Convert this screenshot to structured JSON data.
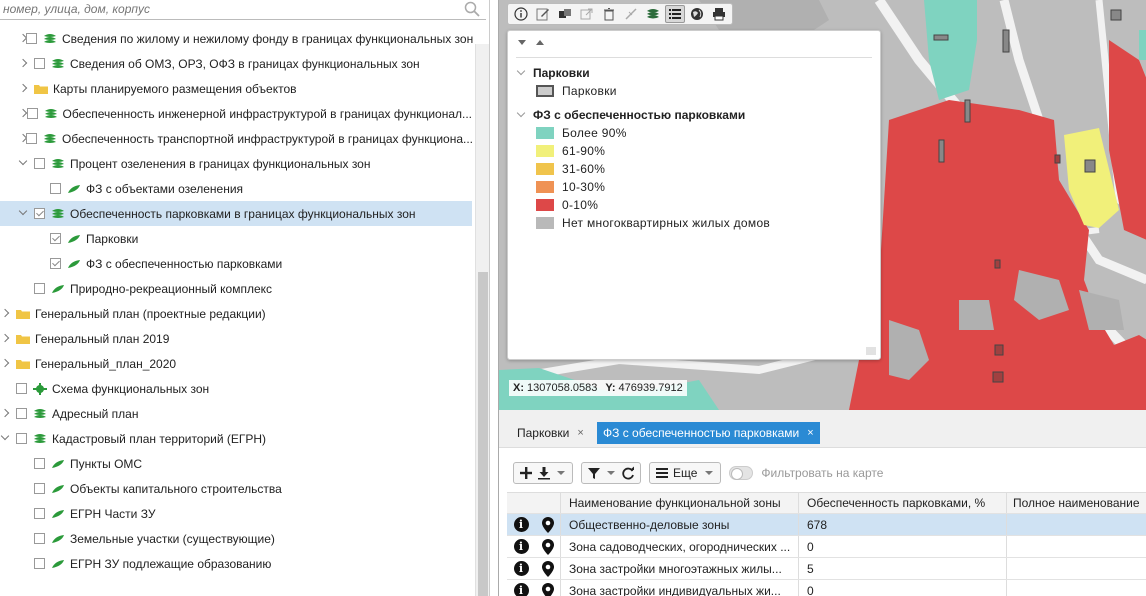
{
  "search": {
    "placeholder": "номер, улица, дом, корпус"
  },
  "tree": [
    {
      "label": "Сведения по жилому и нежилому фонду в границах функциональных зон"
    },
    {
      "label": "Сведения об ОМЗ, ОРЗ, ОФЗ в границах функциональных зон"
    },
    {
      "label": "Карты планируемого размещения объектов"
    },
    {
      "label": "Обеспеченность инженерной инфраструктурой в границах функционал..."
    },
    {
      "label": "Обеспеченность транспортной инфраструктурой в границах функциона..."
    },
    {
      "label": "Процент озеленения в границах функциональных зон"
    },
    {
      "label": "ФЗ с объектами озеленения"
    },
    {
      "label": "Обеспеченность парковками в границах функциональных зон"
    },
    {
      "label": "Парковки"
    },
    {
      "label": "ФЗ с обеспеченностью парковками"
    },
    {
      "label": "Природно-рекреационный комплекс"
    },
    {
      "label": "Генеральный план (проектные редакции)"
    },
    {
      "label": "Генеральный план 2019"
    },
    {
      "label": "Генеральный_план_2020"
    },
    {
      "label": "Схема функциональных зон"
    },
    {
      "label": "Адресный план"
    },
    {
      "label": "Кадастровый план территорий (ЕГРН)"
    },
    {
      "label": "Пункты ОМС"
    },
    {
      "label": "Объекты капитального строительства"
    },
    {
      "label": "ЕГРН Части ЗУ"
    },
    {
      "label": "Земельные участки (существующие)"
    },
    {
      "label": "ЕГРН ЗУ подлежащие образованию"
    }
  ],
  "map_toolbar": [
    {
      "icon": "info-icon"
    },
    {
      "icon": "edit-icon"
    },
    {
      "icon": "layers-swap-icon"
    },
    {
      "icon": "export-icon"
    },
    {
      "icon": "trash-icon"
    },
    {
      "icon": "measure-icon"
    },
    {
      "icon": "layers-icon"
    },
    {
      "icon": "legend-list-icon"
    },
    {
      "icon": "globe-icon"
    },
    {
      "icon": "print-icon"
    }
  ],
  "legend": {
    "groups": [
      {
        "title": "Парковки",
        "items": [
          {
            "label": "Парковки",
            "color": "#cccccc",
            "border": "#555555"
          }
        ]
      },
      {
        "title": "ФЗ с обеспеченностью парковками",
        "items": [
          {
            "label": "Более 90%",
            "color": "#7fd3c0"
          },
          {
            "label": "61-90%",
            "color": "#f1f07a"
          },
          {
            "label": "31-60%",
            "color": "#f0c44c"
          },
          {
            "label": "10-30%",
            "color": "#ef9254"
          },
          {
            "label": "0-10%",
            "color": "#dd4848"
          },
          {
            "label": "Нет многоквартирных жилых домов",
            "color": "#b9b9b9"
          }
        ]
      }
    ]
  },
  "coords": {
    "x_label": "X:",
    "x": "1307058.0583",
    "y_label": "Y:",
    "y": "476939.7912"
  },
  "tabs": [
    {
      "label": "Парковки",
      "close": "×"
    },
    {
      "label": "ФЗ с обеспеченностью парковками",
      "close": "×"
    }
  ],
  "toolbar": {
    "more_label": "Еще",
    "filter_label": "Фильтровать на карте"
  },
  "table": {
    "columns": [
      "Наименование функциональной зоны",
      "Обеспеченность парковками, %",
      "Полное наименование"
    ],
    "rows": [
      [
        "Общественно-деловые зоны",
        "678",
        ""
      ],
      [
        "Зона садоводческих, огороднических ...",
        "0",
        ""
      ],
      [
        "Зона застройки многоэтажных жилы...",
        "5",
        ""
      ],
      [
        "Зона застройки индивидуальных жи...",
        "0",
        ""
      ]
    ]
  },
  "colors": {
    "accent": "#2a8ad4",
    "selection": "#cfe2f3",
    "layer_green": "#2b9a3a"
  }
}
